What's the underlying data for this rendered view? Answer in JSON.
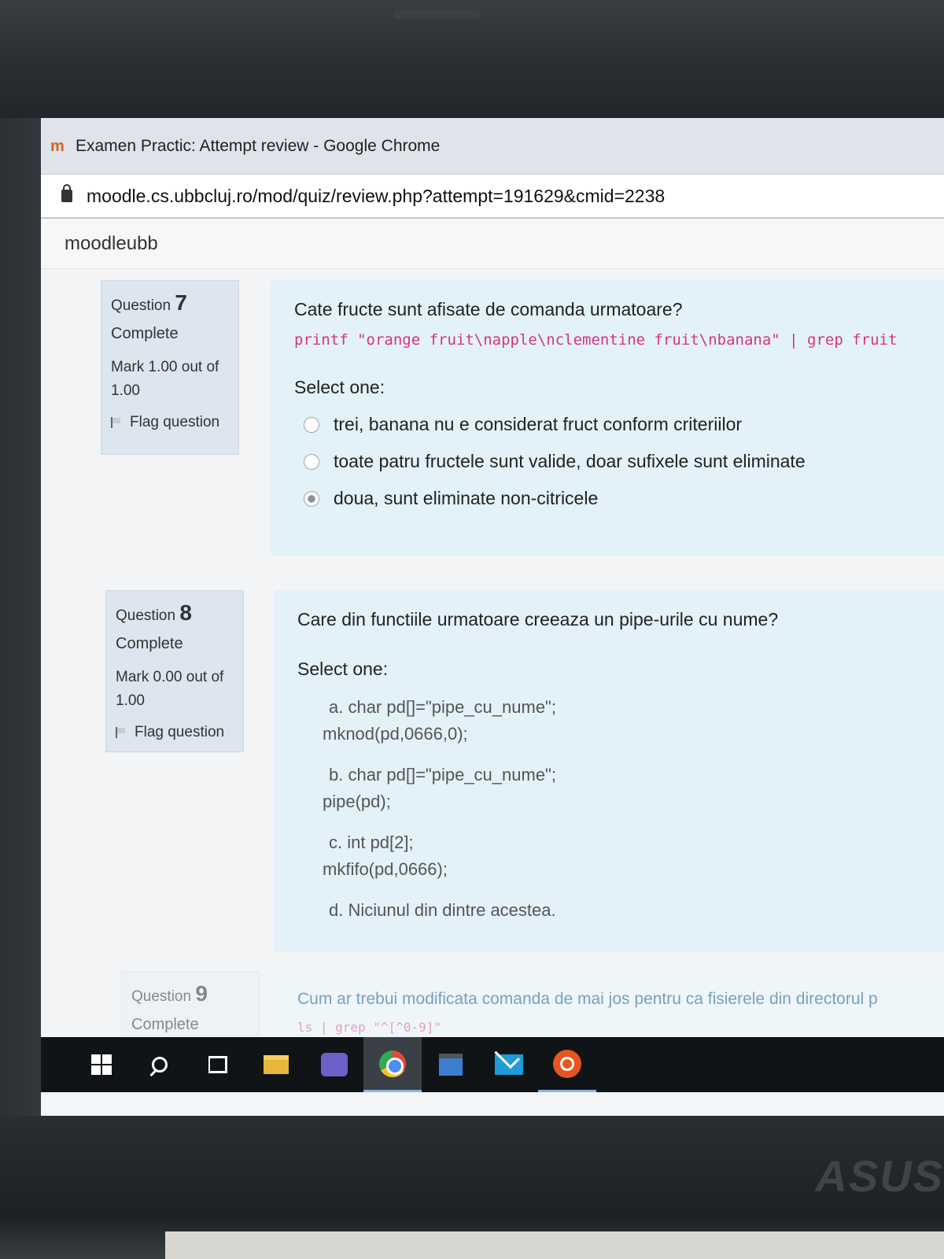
{
  "window": {
    "title": "Examen Practic: Attempt review - Google Chrome",
    "url": "moodle.cs.ubbcluj.ro/mod/quiz/review.php?attempt=191629&cmid=2238"
  },
  "site": {
    "name": "moodleubb"
  },
  "questions": [
    {
      "label": "Question",
      "number": "7",
      "state": "Complete",
      "grade": "Mark 1.00 out of 1.00",
      "flag": "Flag question",
      "text": "Cate fructe sunt afisate de comanda urmatoare?",
      "code": "printf \"orange fruit\\napple\\nclementine fruit\\nbanana\" | grep fruit",
      "prompt": "Select one:",
      "options": [
        {
          "label": "trei, banana nu e considerat fruct conform criteriilor",
          "selected": false
        },
        {
          "label": "toate patru fructele sunt valide, doar sufixele sunt eliminate",
          "selected": false
        },
        {
          "label": "doua, sunt eliminate non-citricele",
          "selected": true
        }
      ]
    },
    {
      "label": "Question",
      "number": "8",
      "state": "Complete",
      "grade": "Mark 0.00 out of 1.00",
      "flag": "Flag question",
      "text": "Care din functiile urmatoare creeaza un pipe-urile cu nume?",
      "prompt": "Select one:",
      "options": [
        {
          "line1": "a. char pd[]=\"pipe_cu_nume\";",
          "line2": "mknod(pd,0666,0);",
          "selected": true
        },
        {
          "line1": "b. char pd[]=\"pipe_cu_nume\";",
          "line2": "pipe(pd);",
          "selected": false
        },
        {
          "line1": "c. int pd[2];",
          "line2": "mkfifo(pd,0666);",
          "selected": false
        },
        {
          "line1": "d. Niciunul din dintre acestea.",
          "line2": "",
          "selected": false
        }
      ]
    },
    {
      "label": "Question",
      "number": "9",
      "state": "Complete",
      "text": "Cum ar trebui modificata comanda de mai jos pentru ca fisierele din directorul p",
      "code": "ls | grep \"^[^0-9]\""
    }
  ],
  "taskbar": {
    "items": [
      "windows-start-icon",
      "search-icon",
      "task-view-icon",
      "file-explorer-icon",
      "teams-icon",
      "chrome-icon",
      "store-icon",
      "mail-icon",
      "ubuntu-icon"
    ],
    "active": "chrome-icon"
  },
  "laptop": {
    "brand": "ASUS"
  }
}
